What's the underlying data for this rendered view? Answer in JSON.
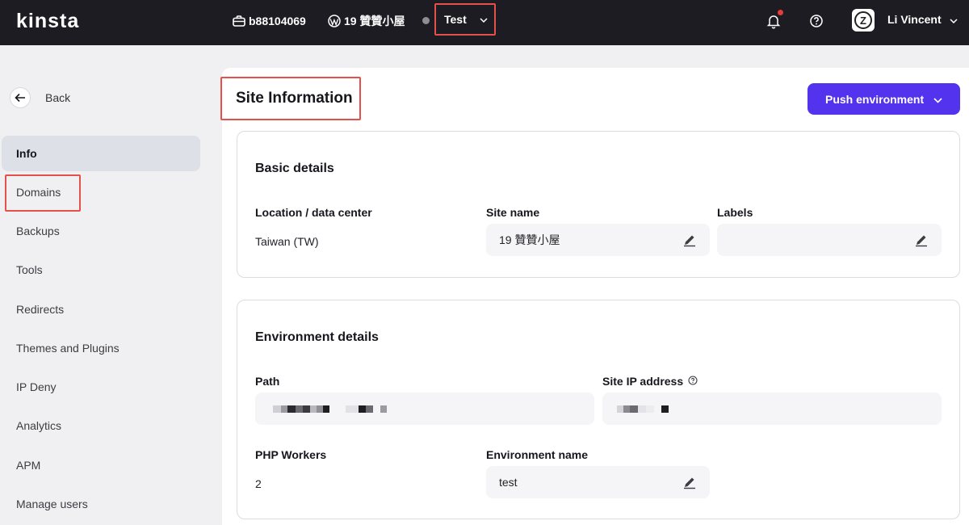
{
  "topbar": {
    "logo": "KINSta",
    "company_id": "b88104069",
    "site": "19 贊贊小屋",
    "environment": "Test",
    "user_name": "Li Vincent",
    "avatar_letter": "Z"
  },
  "sidebar": {
    "back_label": "Back",
    "items": [
      {
        "label": "Info",
        "active": true
      },
      {
        "label": "Domains"
      },
      {
        "label": "Backups"
      },
      {
        "label": "Tools"
      },
      {
        "label": "Redirects"
      },
      {
        "label": "Themes and Plugins"
      },
      {
        "label": "IP Deny"
      },
      {
        "label": "Analytics"
      },
      {
        "label": "APM"
      },
      {
        "label": "Manage users"
      }
    ]
  },
  "main": {
    "title": "Site Information",
    "push_button": "Push environment",
    "basic": {
      "title": "Basic details",
      "location_label": "Location / data center",
      "location_value": "Taiwan (TW)",
      "site_name_label": "Site name",
      "site_name_value": "19 贊贊小屋",
      "labels_label": "Labels",
      "labels_value": ""
    },
    "environment": {
      "title": "Environment details",
      "path_label": "Path",
      "ip_label": "Site IP address",
      "php_label": "PHP Workers",
      "php_value": "2",
      "env_name_label": "Environment name",
      "env_name_value": "test"
    }
  },
  "colors": {
    "accent": "#5333ed",
    "topbar": "#1c1c22",
    "highlight": "#e5514a"
  }
}
